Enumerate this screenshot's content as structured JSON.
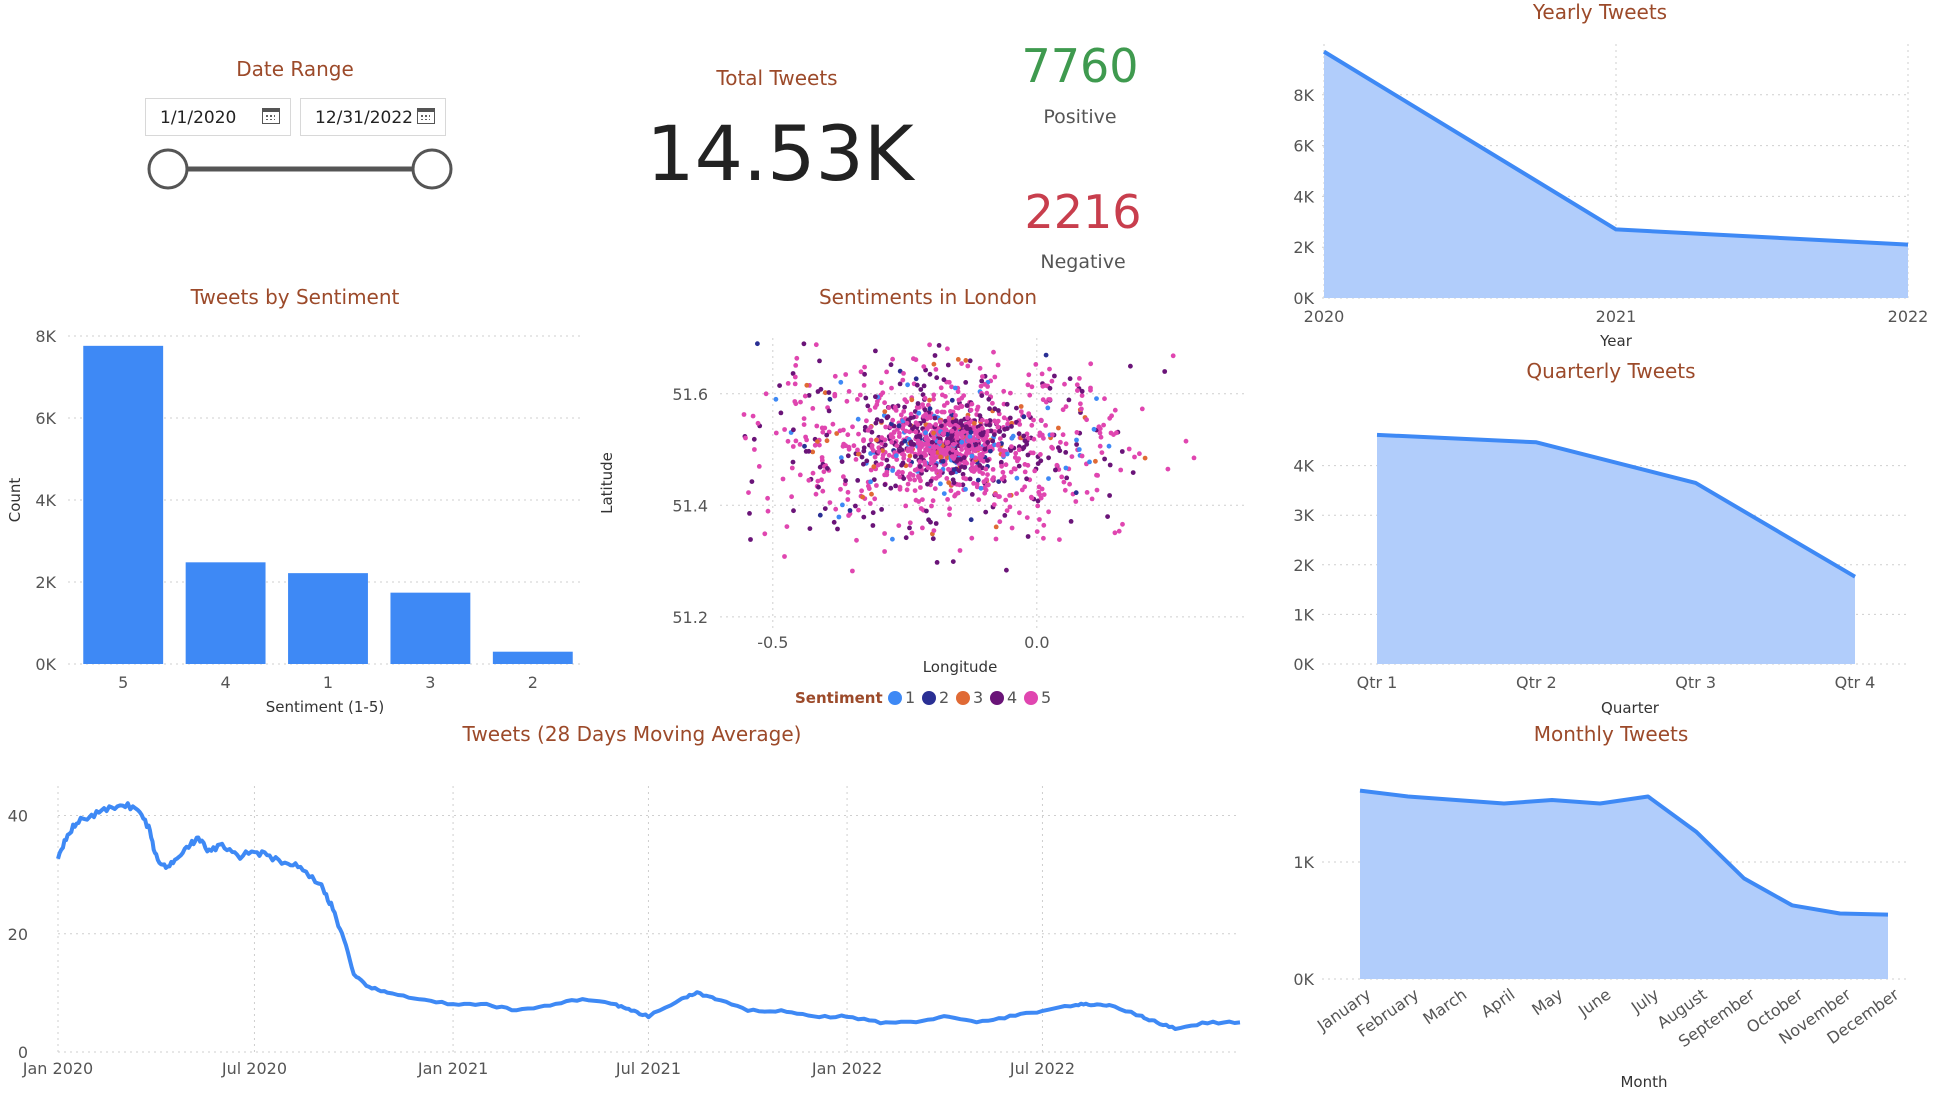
{
  "date_range": {
    "title": "Date Range",
    "start": "1/1/2020",
    "end": "12/31/2022",
    "slider": {
      "start_fraction": 0,
      "end_fraction": 1
    }
  },
  "kpi": {
    "total_title": "Total Tweets",
    "total_value": "14.53K",
    "positive_value": "7760",
    "positive_label": "Positive",
    "negative_value": "2216",
    "negative_label": "Negative",
    "positive_color": "#3f9a4f",
    "negative_color": "#c83e4d"
  },
  "colors": {
    "bar": "#3e89f5",
    "line": "#3e89f5",
    "area_fill": "#b1cdfb",
    "title": "#9c4a2a"
  },
  "chart_data": [
    {
      "id": "sentiment_bar",
      "type": "bar",
      "title": "Tweets by Sentiment",
      "xlabel": "Sentiment (1-5)",
      "ylabel": "Count",
      "categories": [
        "5",
        "4",
        "1",
        "3",
        "2"
      ],
      "values": [
        7760,
        2480,
        2216,
        1740,
        300
      ],
      "ylim": [
        0,
        8000
      ],
      "yticks": [
        0,
        2000,
        4000,
        6000,
        8000
      ],
      "ytick_labels": [
        "0K",
        "2K",
        "4K",
        "6K",
        "8K"
      ],
      "grid": true
    },
    {
      "id": "london_scatter",
      "type": "scatter",
      "title": "Sentiments in London",
      "xlabel": "Longitude",
      "ylabel": "Latitude",
      "xlim": [
        -0.6,
        0.4
      ],
      "ylim": [
        51.18,
        51.7
      ],
      "xticks": [
        -0.5,
        0.0
      ],
      "xtick_labels": [
        "-0.5",
        "0.0"
      ],
      "yticks": [
        51.2,
        51.4,
        51.6
      ],
      "ytick_labels": [
        "51.2",
        "51.4",
        "51.6"
      ],
      "legend_title": "Sentiment",
      "legend_position": "bottom",
      "series": [
        {
          "name": "1",
          "color": "#3e89f5",
          "share": 0.06
        },
        {
          "name": "2",
          "color": "#2a2f94",
          "share": 0.03
        },
        {
          "name": "3",
          "color": "#e06a35",
          "share": 0.05
        },
        {
          "name": "4",
          "color": "#6a1478",
          "share": 0.26
        },
        {
          "name": "5",
          "color": "#e046b0",
          "share": 0.6
        }
      ],
      "distribution": {
        "center_x": -0.17,
        "center_y": 51.51,
        "spread_x": 0.17,
        "spread_y": 0.08
      },
      "grid": true
    },
    {
      "id": "yearly_area",
      "type": "area",
      "title": "Yearly Tweets",
      "xlabel": "Year",
      "categories": [
        "2020",
        "2021",
        "2022"
      ],
      "values": [
        9700,
        2700,
        2100
      ],
      "ylim": [
        0,
        10000
      ],
      "yticks": [
        0,
        2000,
        4000,
        6000,
        8000
      ],
      "ytick_labels": [
        "0K",
        "2K",
        "4K",
        "6K",
        "8K"
      ],
      "grid": true
    },
    {
      "id": "quarterly_area",
      "type": "area",
      "title": "Quarterly Tweets",
      "xlabel": "Quarter",
      "categories": [
        "Qtr 1",
        "Qtr 2",
        "Qtr 3",
        "Qtr 4"
      ],
      "values": [
        4620,
        4470,
        3650,
        1760
      ],
      "ylim": [
        0,
        5000
      ],
      "yticks": [
        0,
        1000,
        2000,
        3000,
        4000
      ],
      "ytick_labels": [
        "0K",
        "1K",
        "2K",
        "3K",
        "4K"
      ],
      "grid": true
    },
    {
      "id": "monthly_area",
      "type": "area",
      "title": "Monthly Tweets",
      "xlabel": "Month",
      "categories": [
        "January",
        "February",
        "March",
        "April",
        "May",
        "June",
        "July",
        "August",
        "September",
        "October",
        "November",
        "December"
      ],
      "values": [
        1610,
        1560,
        1530,
        1500,
        1530,
        1500,
        1560,
        1260,
        860,
        630,
        560,
        550
      ],
      "ylim": [
        0,
        2000
      ],
      "yticks": [
        0,
        1000
      ],
      "ytick_labels": [
        "0K",
        "1K"
      ],
      "grid": true
    },
    {
      "id": "moving_avg_line",
      "type": "line",
      "title": "Tweets (28 Days Moving Average)",
      "x": [
        "2020-01-01",
        "2020-01-10",
        "2020-01-20",
        "2020-02-01",
        "2020-02-15",
        "2020-03-01",
        "2020-03-15",
        "2020-03-25",
        "2020-04-01",
        "2020-04-10",
        "2020-04-20",
        "2020-05-01",
        "2020-05-10",
        "2020-05-20",
        "2020-06-01",
        "2020-06-15",
        "2020-07-01",
        "2020-07-15",
        "2020-08-01",
        "2020-08-15",
        "2020-09-01",
        "2020-09-10",
        "2020-09-20",
        "2020-10-01",
        "2020-10-15",
        "2020-11-01",
        "2020-12-01",
        "2021-01-01",
        "2021-02-01",
        "2021-03-01",
        "2021-04-01",
        "2021-05-01",
        "2021-06-01",
        "2021-06-15",
        "2021-07-01",
        "2021-08-01",
        "2021-08-15",
        "2021-09-01",
        "2021-10-01",
        "2021-11-01",
        "2021-12-01",
        "2022-01-01",
        "2022-02-01",
        "2022-03-01",
        "2022-04-01",
        "2022-05-01",
        "2022-06-01",
        "2022-07-01",
        "2022-08-01",
        "2022-08-15",
        "2022-09-01",
        "2022-10-01",
        "2022-10-15",
        "2022-11-01",
        "2022-12-01",
        "2022-12-31"
      ],
      "y": [
        33,
        37,
        39,
        40,
        41,
        42,
        41,
        38,
        33,
        31,
        33,
        35,
        36,
        34,
        35,
        33,
        34,
        33,
        32,
        31,
        28,
        25,
        20,
        13,
        11,
        10,
        9,
        8,
        8,
        7,
        8,
        9,
        8,
        7,
        6,
        9,
        10,
        9,
        7,
        7,
        6,
        6,
        5,
        5,
        6,
        5,
        6,
        7,
        8,
        8,
        8,
        6,
        5,
        4,
        5,
        5
      ],
      "ylim": [
        0,
        45
      ],
      "yticks": [
        0,
        20,
        40
      ],
      "ytick_labels": [
        "0",
        "20",
        "40"
      ],
      "xticks": [
        "2020-01-01",
        "2020-07-01",
        "2021-01-01",
        "2021-07-01",
        "2022-01-01",
        "2022-07-01"
      ],
      "xtick_labels": [
        "Jan 2020",
        "Jul 2020",
        "Jan 2021",
        "Jul 2021",
        "Jan 2022",
        "Jul 2022"
      ],
      "grid": true
    }
  ]
}
